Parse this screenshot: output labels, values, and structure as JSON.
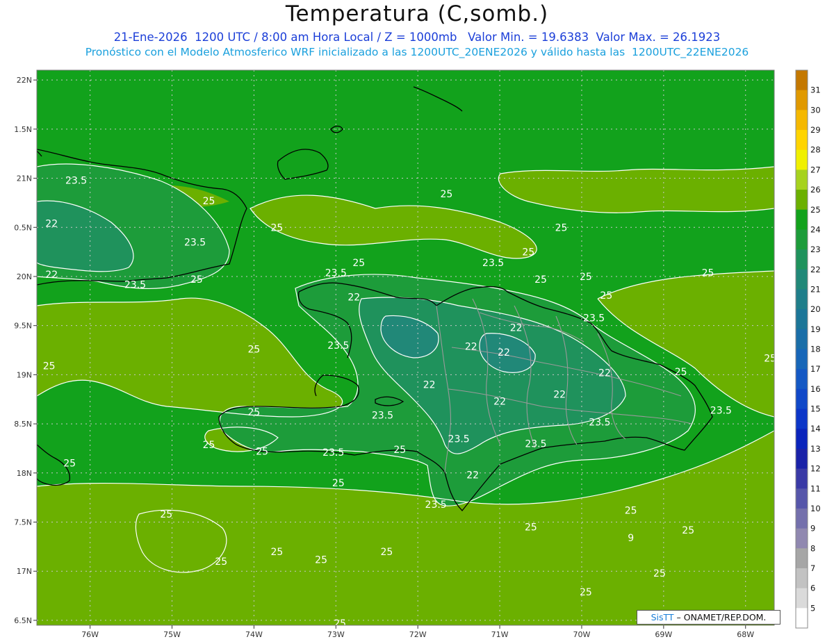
{
  "header": {
    "title": "Temperatura (C,somb.)",
    "subtitle1": "21-Ene-2026  1200 UTC / 8:00 am Hora Local / Z = 1000mb   Valor Min. = 19.6383  Valor Max. = 26.1923",
    "subtitle2": "Pronóstico con el Modelo Atmosferico WRF inicializado a las 1200UTC_20ENE2026 y válido hasta las  1200UTC_22ENE2026"
  },
  "map": {
    "lon_range": [
      -76.65,
      -67.65
    ],
    "lat_range": [
      16.45,
      22.1
    ],
    "lon_ticks": [
      {
        "lon": -76,
        "label": "76W"
      },
      {
        "lon": -75,
        "label": "75W"
      },
      {
        "lon": -74,
        "label": "74W"
      },
      {
        "lon": -73,
        "label": "73W"
      },
      {
        "lon": -72,
        "label": "72W"
      },
      {
        "lon": -71,
        "label": "71W"
      },
      {
        "lon": -70,
        "label": "70W"
      },
      {
        "lon": -69,
        "label": "69W"
      },
      {
        "lon": -68,
        "label": "68W"
      }
    ],
    "lat_ticks": [
      {
        "lat": 22,
        "label": "22N"
      },
      {
        "lat": 21.5,
        "label": "1.5N"
      },
      {
        "lat": 21,
        "label": "21N"
      },
      {
        "lat": 20.5,
        "label": "0.5N"
      },
      {
        "lat": 20,
        "label": "20N"
      },
      {
        "lat": 19.5,
        "label": "9.5N"
      },
      {
        "lat": 19,
        "label": "19N"
      },
      {
        "lat": 18.5,
        "label": "8.5N"
      },
      {
        "lat": 18,
        "label": "18N"
      },
      {
        "lat": 17.5,
        "label": "7.5N"
      },
      {
        "lat": 17,
        "label": "17N"
      },
      {
        "lat": 16.5,
        "label": "6.5N"
      }
    ],
    "colors": {
      "t24": "#12a21c",
      "t25": "#6bb000",
      "t23": "#1d9c3a",
      "t22": "#1f925c",
      "t21": "#218878",
      "coast": "#000000",
      "border": "#9a9a9a",
      "contour": "#ffffff"
    },
    "contour_labels": [
      {
        "lon": -76.17,
        "lat": 20.98,
        "text": "23.5"
      },
      {
        "lon": -76.47,
        "lat": 20.54,
        "text": "22"
      },
      {
        "lon": -76.47,
        "lat": 20.02,
        "text": "22"
      },
      {
        "lon": -74.55,
        "lat": 20.77,
        "text": "25"
      },
      {
        "lon": -74.72,
        "lat": 20.35,
        "text": "23.5"
      },
      {
        "lon": -75.45,
        "lat": 19.92,
        "text": "23.5"
      },
      {
        "lon": -74.7,
        "lat": 19.97,
        "text": "25"
      },
      {
        "lon": -73.72,
        "lat": 20.5,
        "text": "25"
      },
      {
        "lon": -72.72,
        "lat": 20.14,
        "text": "25"
      },
      {
        "lon": -73.0,
        "lat": 20.04,
        "text": "23.5"
      },
      {
        "lon": -71.65,
        "lat": 20.84,
        "text": "25"
      },
      {
        "lon": -71.08,
        "lat": 20.14,
        "text": "23.5"
      },
      {
        "lon": -72.78,
        "lat": 19.79,
        "text": "22"
      },
      {
        "lon": -70.25,
        "lat": 20.5,
        "text": "25"
      },
      {
        "lon": -70.65,
        "lat": 20.25,
        "text": "25"
      },
      {
        "lon": -70.5,
        "lat": 19.97,
        "text": "25"
      },
      {
        "lon": -69.95,
        "lat": 20.0,
        "text": "25"
      },
      {
        "lon": -69.7,
        "lat": 19.81,
        "text": "25"
      },
      {
        "lon": -68.46,
        "lat": 20.04,
        "text": "25"
      },
      {
        "lon": -69.85,
        "lat": 19.58,
        "text": "23.5"
      },
      {
        "lon": -70.8,
        "lat": 19.48,
        "text": "22"
      },
      {
        "lon": -71.35,
        "lat": 19.29,
        "text": "22"
      },
      {
        "lon": -70.95,
        "lat": 19.23,
        "text": "22"
      },
      {
        "lon": -72.97,
        "lat": 19.3,
        "text": "23.5"
      },
      {
        "lon": -74.0,
        "lat": 19.26,
        "text": "25"
      },
      {
        "lon": -76.5,
        "lat": 19.09,
        "text": "25"
      },
      {
        "lon": -67.7,
        "lat": 19.17,
        "text": "25"
      },
      {
        "lon": -68.79,
        "lat": 19.03,
        "text": "25"
      },
      {
        "lon": -69.72,
        "lat": 19.02,
        "text": "22"
      },
      {
        "lon": -71.86,
        "lat": 18.9,
        "text": "22"
      },
      {
        "lon": -71.0,
        "lat": 18.73,
        "text": "22"
      },
      {
        "lon": -70.27,
        "lat": 18.8,
        "text": "22"
      },
      {
        "lon": -68.3,
        "lat": 18.64,
        "text": "23.5"
      },
      {
        "lon": -72.43,
        "lat": 18.59,
        "text": "23.5"
      },
      {
        "lon": -69.78,
        "lat": 18.52,
        "text": "23.5"
      },
      {
        "lon": -74.0,
        "lat": 18.62,
        "text": "25"
      },
      {
        "lon": -74.55,
        "lat": 18.29,
        "text": "25"
      },
      {
        "lon": -73.9,
        "lat": 18.22,
        "text": "25"
      },
      {
        "lon": -73.03,
        "lat": 18.21,
        "text": "23.5"
      },
      {
        "lon": -72.22,
        "lat": 18.24,
        "text": "25"
      },
      {
        "lon": -71.5,
        "lat": 18.35,
        "text": "23.5"
      },
      {
        "lon": -70.56,
        "lat": 18.3,
        "text": "23.5"
      },
      {
        "lon": -76.25,
        "lat": 18.1,
        "text": "25"
      },
      {
        "lon": -71.33,
        "lat": 17.98,
        "text": "22"
      },
      {
        "lon": -72.97,
        "lat": 17.9,
        "text": "25"
      },
      {
        "lon": -71.78,
        "lat": 17.68,
        "text": "23.5"
      },
      {
        "lon": -75.07,
        "lat": 17.58,
        "text": "25"
      },
      {
        "lon": -70.62,
        "lat": 17.45,
        "text": "25"
      },
      {
        "lon": -69.4,
        "lat": 17.62,
        "text": "25"
      },
      {
        "lon": -69.4,
        "lat": 17.34,
        "text": "9"
      },
      {
        "lon": -68.7,
        "lat": 17.42,
        "text": "25"
      },
      {
        "lon": -73.72,
        "lat": 17.2,
        "text": "25"
      },
      {
        "lon": -73.18,
        "lat": 17.12,
        "text": "25"
      },
      {
        "lon": -72.38,
        "lat": 17.2,
        "text": "25"
      },
      {
        "lon": -74.4,
        "lat": 17.1,
        "text": "25"
      },
      {
        "lon": -69.05,
        "lat": 16.98,
        "text": "25"
      },
      {
        "lon": -69.95,
        "lat": 16.79,
        "text": "25"
      },
      {
        "lon": -72.95,
        "lat": 16.47,
        "text": "25"
      }
    ]
  },
  "colorbar": {
    "levels": [
      {
        "label": "31",
        "color": "#c47800"
      },
      {
        "label": "30",
        "color": "#e09900"
      },
      {
        "label": "29",
        "color": "#f5b800"
      },
      {
        "label": "28",
        "color": "#ffd400"
      },
      {
        "label": "27",
        "color": "#f0f000"
      },
      {
        "label": "26",
        "color": "#a6d21e"
      },
      {
        "label": "25",
        "color": "#6bb000"
      },
      {
        "label": "24",
        "color": "#12a21c"
      },
      {
        "label": "23",
        "color": "#1d9c3a"
      },
      {
        "label": "22",
        "color": "#1f925c"
      },
      {
        "label": "21",
        "color": "#218878"
      },
      {
        "label": "20",
        "color": "#1f7e8a"
      },
      {
        "label": "19",
        "color": "#1c7698"
      },
      {
        "label": "18",
        "color": "#1a6ea8"
      },
      {
        "label": "17",
        "color": "#1766b8"
      },
      {
        "label": "16",
        "color": "#1458c4"
      },
      {
        "label": "15",
        "color": "#1048c8"
      },
      {
        "label": "14",
        "color": "#0c36c8"
      },
      {
        "label": "13",
        "color": "#0a24bc"
      },
      {
        "label": "12",
        "color": "#1a22a8"
      },
      {
        "label": "11",
        "color": "#3a3aa6"
      },
      {
        "label": "10",
        "color": "#5656aa"
      },
      {
        "label": "9",
        "color": "#7470ac"
      },
      {
        "label": "8",
        "color": "#9088b0"
      },
      {
        "label": "7",
        "color": "#a6a6a6"
      },
      {
        "label": "6",
        "color": "#c2c2c2"
      },
      {
        "label": "5",
        "color": "#dadada"
      },
      {
        "label": "",
        "color": "#ffffff"
      }
    ]
  },
  "credit": {
    "brand": "SisTT",
    "text": "– ONAMET/REP.DOM."
  }
}
